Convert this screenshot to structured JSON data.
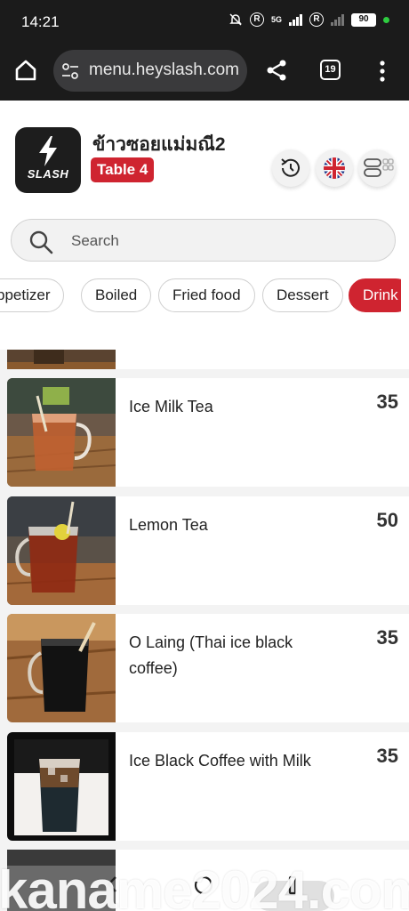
{
  "status_bar": {
    "time": "14:21",
    "network": "5G",
    "battery": "90"
  },
  "browser": {
    "url": "menu.heyslash.com",
    "tab_count": "19"
  },
  "header": {
    "logo_text": "SLASH",
    "shop_name": "ข้าวซอยแม่มณี2",
    "table_label": "Table 4"
  },
  "search": {
    "placeholder": "Search"
  },
  "categories": [
    {
      "label": "ppetizer",
      "active": false
    },
    {
      "label": "Boiled",
      "active": false
    },
    {
      "label": "Fried food",
      "active": false
    },
    {
      "label": "Dessert",
      "active": false
    },
    {
      "label": "Drink",
      "active": true
    }
  ],
  "menu_items": [
    {
      "name": "Ice Milk Tea",
      "price": "35"
    },
    {
      "name": "Lemon Tea",
      "price": "50"
    },
    {
      "name": "O Laing (Thai ice black coffee)",
      "price": "35"
    },
    {
      "name": "Ice Black Coffee with Milk",
      "price": "35"
    }
  ],
  "watermark": "kaname2024.com",
  "colors": {
    "accent": "#cf2430",
    "dark_bar": "#1b1b1b"
  }
}
